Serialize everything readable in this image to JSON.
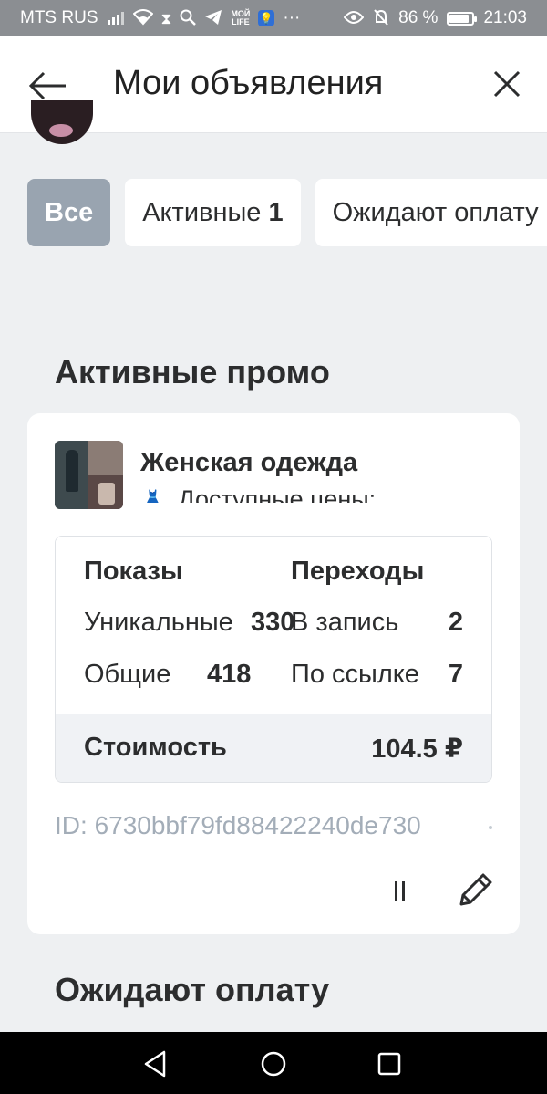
{
  "status_bar": {
    "carrier": "MTS RUS",
    "network_icons": [
      "signal-icon",
      "wifi-icon",
      "hourglass-icon",
      "search-icon",
      "telegram-icon"
    ],
    "mymtslife_label_top": "MOЙ",
    "mymtslife_label_bottom": "LIFE",
    "more": "···",
    "battery_percent": "86 %",
    "battery_level": 0.86,
    "time": "21:03"
  },
  "header": {
    "title": "Мои объявления"
  },
  "filters": [
    {
      "label": "Все",
      "count": "",
      "active": true
    },
    {
      "label": "Активные",
      "count": "1",
      "active": false
    },
    {
      "label": "Ожидают оплату",
      "count": "",
      "active": false
    }
  ],
  "sections": {
    "active_title": "Активные промо",
    "pending_title": "Ожидают оплату"
  },
  "promo": {
    "group_name": "Женская одежда",
    "group_subtitle": "Доступные цены:",
    "impressions_header": "Показы",
    "clicks_header": "Переходы",
    "unique_label": "Уникальные",
    "unique_value": "330",
    "total_label": "Общие",
    "total_value": "418",
    "to_post_label": "В запись",
    "to_post_value": "2",
    "by_link_label": "По ссылке",
    "by_link_value": "7",
    "cost_label": "Стоимость",
    "cost_value": "104.5 ₽",
    "id_label": "ID:",
    "id_value": "6730bbf79fd88422240de730"
  }
}
